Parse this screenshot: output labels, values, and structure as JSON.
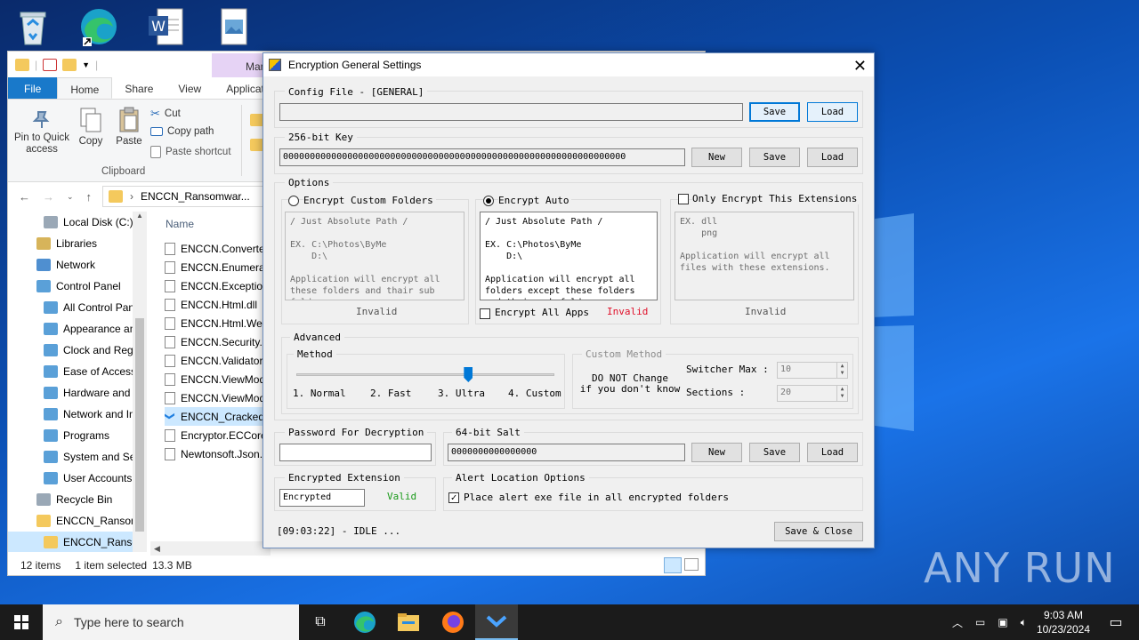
{
  "desktop": {
    "icons": [
      "recycle-bin-icon",
      "edge-icon",
      "word-document-icon",
      "image-file-icon"
    ]
  },
  "explorer": {
    "manage_tab": "Manage",
    "tabs": [
      "File",
      "Home",
      "Share",
      "View",
      "Application Tools"
    ],
    "ribbon": {
      "pin_label": "Pin to Quick access",
      "copy_label": "Copy",
      "paste_label": "Paste",
      "cut_label": "Cut",
      "copy_path_label": "Copy path",
      "paste_shortcut_label": "Paste shortcut",
      "group_label": "Clipboard"
    },
    "address": "ENCCN_Ransomwar...",
    "nav_items": [
      {
        "label": "Local Disk (C:)",
        "indent": 1
      },
      {
        "label": "Libraries",
        "indent": 0
      },
      {
        "label": "Network",
        "indent": 0
      },
      {
        "label": "Control Panel",
        "indent": 0
      },
      {
        "label": "All Control Panel Items",
        "indent": 1
      },
      {
        "label": "Appearance and Personalization",
        "indent": 1
      },
      {
        "label": "Clock and Region",
        "indent": 1
      },
      {
        "label": "Ease of Access",
        "indent": 1
      },
      {
        "label": "Hardware and Sound",
        "indent": 1
      },
      {
        "label": "Network and Internet",
        "indent": 1
      },
      {
        "label": "Programs",
        "indent": 1
      },
      {
        "label": "System and Security",
        "indent": 1
      },
      {
        "label": "User Accounts",
        "indent": 1
      },
      {
        "label": "Recycle Bin",
        "indent": 0
      },
      {
        "label": "ENCCN_Ransomware",
        "indent": 0
      },
      {
        "label": "ENCCN_Ransomware",
        "indent": 1
      }
    ],
    "column_name": "Name",
    "files": [
      "ENCCN.Converters.dll",
      "ENCCN.Enumerators.dll",
      "ENCCN.Exceptions.dll",
      "ENCCN.Html.dll",
      "ENCCN.Html.WebControls.dll",
      "ENCCN.Security.dll",
      "ENCCN.Validators.dll",
      "ENCCN.ViewModels.dll",
      "ENCCN.ViewModels.dll",
      "ENCCN_Cracked.exe",
      "Encryptor.ECCore.dll",
      "Newtonsoft.Json.dll"
    ],
    "status": {
      "items": "12 items",
      "selected": "1 item selected",
      "size": "13.3 MB"
    }
  },
  "dialog": {
    "title": "Encryption General Settings",
    "config": {
      "label": "Config File - [GENERAL]",
      "value": "",
      "save": "Save",
      "load": "Load"
    },
    "key": {
      "label": "256-bit Key",
      "value": "0000000000000000000000000000000000000000000000000000000000000000",
      "new": "New",
      "save": "Save",
      "load": "Load"
    },
    "options": {
      "label": "Options",
      "custom": {
        "radio_label": "Encrypt Custom Folders",
        "memo": "/ Just Absolute Path /\n\nEX. C:\\Photos\\ByMe\n    D:\\\n\nApplication will encrypt all\nthese folders and thair sub\nfolders",
        "status": "Invalid"
      },
      "auto": {
        "radio_label": "Encrypt Auto",
        "memo": "/ Just Absolute Path /\n\nEX. C:\\Photos\\ByMe\n    D:\\\n\nApplication will encrypt all\nfolders except these folders\nand their sub folders",
        "all_apps_label": "Encrypt All Apps",
        "status": "Invalid"
      },
      "extensions": {
        "check_label": "Only Encrypt This Extensions",
        "memo": "EX. dll\n    png\n\nApplication will encrypt all\nfiles with these extensions.",
        "status": "Invalid"
      }
    },
    "advanced": {
      "label": "Advanced",
      "method_label": "Method",
      "method_ticks": [
        "1. Normal",
        "2. Fast",
        "3. Ultra",
        "4. Custom"
      ],
      "method_value": 3,
      "custom_method_label": "Custom Method",
      "warning": "DO NOT Change\nif you don't know",
      "switcher_label": "Switcher Max :",
      "switcher_value": "10",
      "sections_label": "Sections :",
      "sections_value": "20"
    },
    "password": {
      "label": "Password For Decryption",
      "value": ""
    },
    "salt": {
      "label": "64-bit Salt",
      "value": "0000000000000000",
      "new": "New",
      "save": "Save",
      "load": "Load"
    },
    "extension": {
      "label": "Encrypted Extension",
      "value": "Encrypted",
      "status": "Valid"
    },
    "alert": {
      "label": "Alert Location Options",
      "check_label": "Place alert exe file in all encrypted folders"
    },
    "log": "[09:03:22] - IDLE ...",
    "save_close": "Save & Close"
  },
  "taskbar": {
    "search_placeholder": "Type here to search",
    "time": "9:03 AM",
    "date": "10/23/2024"
  },
  "watermark": "ANY RUN"
}
